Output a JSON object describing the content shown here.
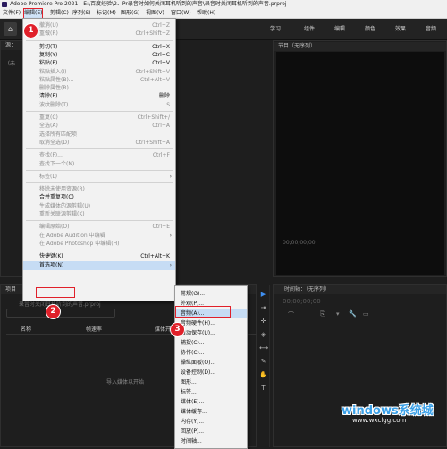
{
  "titlebar": {
    "text": "Adobe Premiere Pro 2021 - E:\\百度经验\\2、Pr录音时如何关闭耳机听到的声音\\录音时关闭耳机听到的声音.prproj"
  },
  "menubar": {
    "items": [
      "文件(F)",
      "编辑(E)",
      "剪辑(C)",
      "序列(S)",
      "标记(M)",
      "图形(G)",
      "视图(V)",
      "窗口(W)",
      "帮助(H)"
    ]
  },
  "workspace_tabs": [
    "学习",
    "组件",
    "编辑",
    "颜色",
    "效果",
    "音频"
  ],
  "panels": {
    "source_label": "源：",
    "source_sub": "（未",
    "program_label": "节目（无序列）",
    "program_timecode": "00;00;00;00",
    "program_timecode_right": "00;00;00;00",
    "timeline_label": "时间轴：（无序列）",
    "timeline_timecode": "00;00;00;00",
    "project_tab": "项目",
    "project_file": "录音时关闭耳机听到的声音.prproj",
    "project_col_name": "名称",
    "project_col_fps": "帧速率",
    "project_col_media": "媒体开",
    "project_import_hint": "导入媒体以开始"
  },
  "edit_menu": [
    {
      "label": "撤消(U)",
      "shortcut": "Ctrl+Z",
      "disabled": true
    },
    {
      "label": "重做(R)",
      "shortcut": "Ctrl+Shift+Z",
      "disabled": true
    },
    {
      "sep": true
    },
    {
      "label": "剪切(T)",
      "shortcut": "Ctrl+X",
      "disabled": false
    },
    {
      "label": "复制(Y)",
      "shortcut": "Ctrl+C",
      "disabled": false
    },
    {
      "label": "粘贴(P)",
      "shortcut": "Ctrl+V",
      "disabled": false
    },
    {
      "label": "粘贴插入(I)",
      "shortcut": "Ctrl+Shift+V",
      "disabled": true
    },
    {
      "label": "粘贴属性(B)...",
      "shortcut": "Ctrl+Alt+V",
      "disabled": true
    },
    {
      "label": "删除属性(R)...",
      "shortcut": "",
      "disabled": true
    },
    {
      "label": "清除(E)",
      "shortcut": "删除",
      "disabled": false
    },
    {
      "label": "波纹删除(T)",
      "shortcut": "S",
      "disabled": true
    },
    {
      "sep": true
    },
    {
      "label": "重复(C)",
      "shortcut": "Ctrl+Shift+/",
      "disabled": true
    },
    {
      "label": "全选(A)",
      "shortcut": "Ctrl+A",
      "disabled": true
    },
    {
      "label": "选择所有匹配项",
      "shortcut": "",
      "disabled": true
    },
    {
      "label": "取消全选(D)",
      "shortcut": "Ctrl+Shift+A",
      "disabled": true
    },
    {
      "sep": true
    },
    {
      "label": "查找(F)...",
      "shortcut": "Ctrl+F",
      "disabled": true
    },
    {
      "label": "查找下一个(N)",
      "shortcut": "",
      "disabled": true
    },
    {
      "sep": true
    },
    {
      "label": "标签(L)",
      "shortcut": "",
      "disabled": true,
      "submenu": true
    },
    {
      "sep": true
    },
    {
      "label": "移除未使用资源(R)",
      "shortcut": "",
      "disabled": true
    },
    {
      "label": "合并重复项(C)",
      "shortcut": "",
      "disabled": false
    },
    {
      "label": "生成媒体的源剪辑(U)",
      "shortcut": "",
      "disabled": true
    },
    {
      "label": "重新关联源剪辑(K)",
      "shortcut": "",
      "disabled": true
    },
    {
      "sep": true
    },
    {
      "label": "编辑原始(O)",
      "shortcut": "Ctrl+E",
      "disabled": true
    },
    {
      "label": "在 Adobe Audition 中编辑",
      "shortcut": "",
      "disabled": true,
      "submenu": true
    },
    {
      "label": "在 Adobe Photoshop 中编辑(H)",
      "shortcut": "",
      "disabled": true
    },
    {
      "sep": true
    },
    {
      "label": "快捷键(K)",
      "shortcut": "Ctrl+Alt+K",
      "disabled": false
    },
    {
      "label": "首选项(N)",
      "shortcut": "",
      "disabled": false,
      "submenu": true,
      "highlight": true
    }
  ],
  "pref_submenu": [
    {
      "label": "常规(G)..."
    },
    {
      "label": "外观(P)..."
    },
    {
      "label": "音频(A)...",
      "highlight": true
    },
    {
      "label": "音频硬件(H)..."
    },
    {
      "label": "自动保存(U)..."
    },
    {
      "label": "捕捉(C)..."
    },
    {
      "label": "协作(C)..."
    },
    {
      "label": "操纵面板(O)..."
    },
    {
      "label": "设备控制(D)..."
    },
    {
      "label": "图形..."
    },
    {
      "label": "标签..."
    },
    {
      "label": "媒体(E)..."
    },
    {
      "label": "媒体缓存..."
    },
    {
      "label": "内存(Y)..."
    },
    {
      "label": "回放(P)..."
    },
    {
      "label": "时间轴..."
    }
  ],
  "steps": [
    "1",
    "2",
    "3"
  ],
  "watermark": {
    "title": "windows系统城",
    "url": "www.wxclgg.com"
  }
}
